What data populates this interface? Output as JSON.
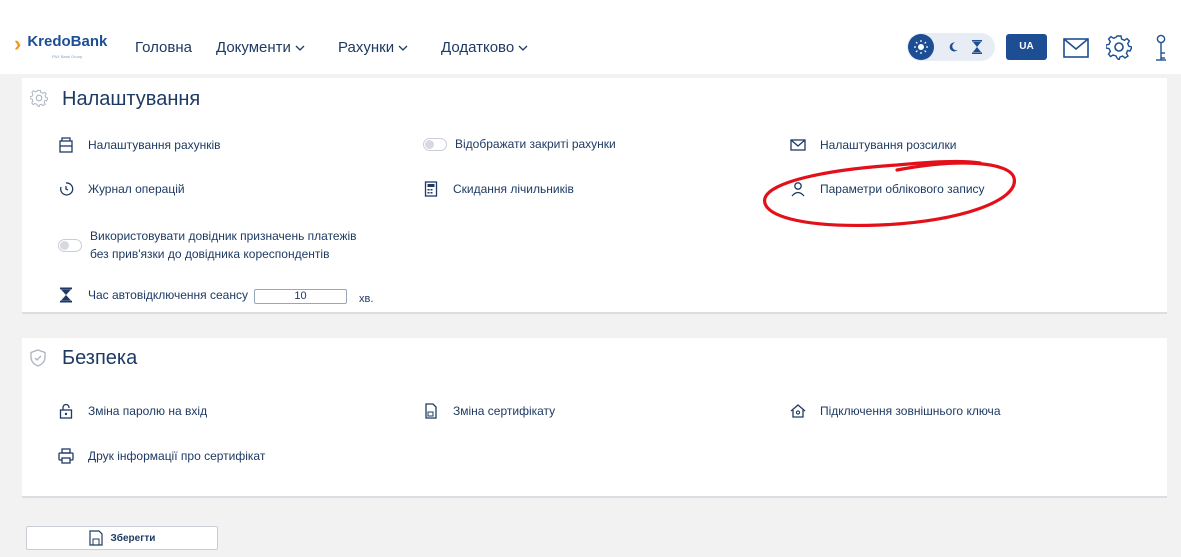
{
  "header": {
    "logo": {
      "brand": "KredoBank",
      "subtitle": "PAX Bank Group"
    },
    "nav": [
      {
        "label": "Головна",
        "has_dropdown": false
      },
      {
        "label": "Документи",
        "has_dropdown": true
      },
      {
        "label": "Рахунки",
        "has_dropdown": true
      },
      {
        "label": "Додатково",
        "has_dropdown": true
      }
    ],
    "theme_switcher": {
      "options": [
        "sun-icon",
        "moon-icon",
        "hourglass-icon"
      ],
      "selected": "sun-icon"
    },
    "language": "UA",
    "icons": [
      "mail-icon",
      "gear-icon",
      "user-key-icon"
    ]
  },
  "settings": {
    "title": "Налаштування",
    "items": {
      "account_settings": "Налаштування рахунків",
      "show_closed": "Відображати закриті рахунки",
      "mailing_settings": "Налаштування розсилки",
      "operations_log": "Журнал операцій",
      "reset_counters": "Скидання лічильників",
      "account_params": "Параметри облікового запису",
      "use_directory": "Використовувати довідник призначень платежів без прив'язки до довідника кореспондентів",
      "session_timeout": "Час автовідключення сеансу",
      "session_timeout_value": "10",
      "session_timeout_unit": "хв."
    },
    "toggles": {
      "show_closed": false,
      "use_directory": false
    }
  },
  "security": {
    "title": "Безпека",
    "items": {
      "change_password": "Зміна паролю на вхід",
      "change_certificate": "Зміна сертифікату",
      "external_key": "Підключення зовнішнього ключа",
      "print_certificate": "Друк інформації про сертифікат"
    }
  },
  "footer": {
    "save_label": "Зберегти"
  },
  "colors": {
    "primary": "#1d4e94",
    "accent": "#f39a1d",
    "annotation": "#e3101a"
  }
}
